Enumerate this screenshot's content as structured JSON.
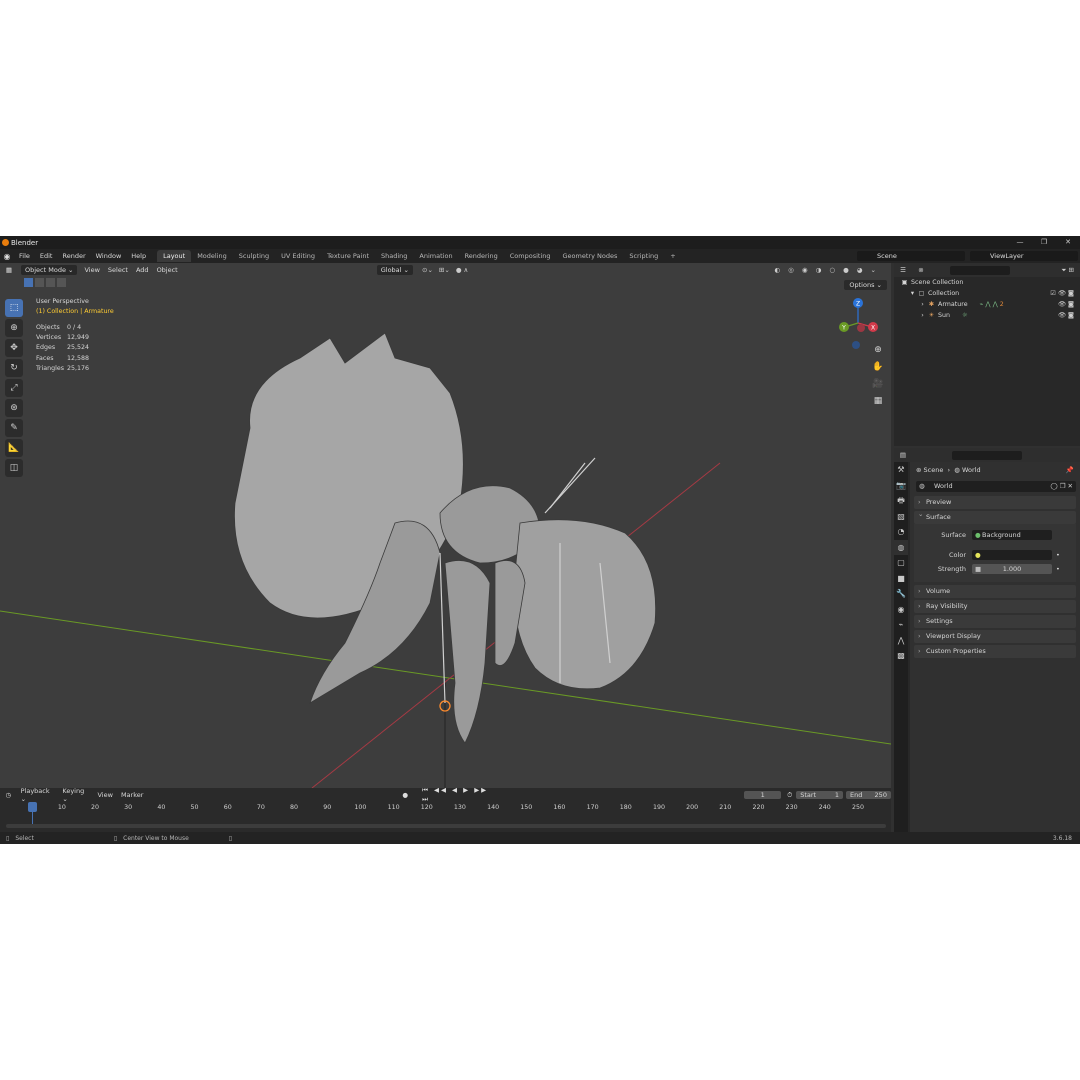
{
  "window": {
    "title": "Blender",
    "controls": [
      "—",
      "❐",
      "✕"
    ]
  },
  "menu": {
    "items": [
      "File",
      "Edit",
      "Render",
      "Window",
      "Help"
    ],
    "tabs": [
      "Layout",
      "Modeling",
      "Sculpting",
      "UV Editing",
      "Texture Paint",
      "Shading",
      "Animation",
      "Rendering",
      "Compositing",
      "Geometry Nodes",
      "Scripting"
    ],
    "active_tab": "Layout",
    "add_tab": "+",
    "scene": "Scene",
    "view_layer": "ViewLayer"
  },
  "viewport_header": {
    "mode": "Object Mode",
    "menus": [
      "View",
      "Select",
      "Add",
      "Object"
    ],
    "transform_orientation": "Global",
    "options": "Options"
  },
  "viewport_overlay": {
    "view_name": "User Perspective",
    "collection_label": "(1) Collection | Armature",
    "stats": [
      {
        "k": "Objects",
        "v": "0 / 4"
      },
      {
        "k": "Vertices",
        "v": "12,949"
      },
      {
        "k": "Edges",
        "v": "25,524"
      },
      {
        "k": "Faces",
        "v": "12,588"
      },
      {
        "k": "Triangles",
        "v": "25,176"
      }
    ],
    "gizmo_axes": [
      "Z",
      "Y",
      "X"
    ]
  },
  "outliner": {
    "root": "Scene Collection",
    "collection": "Collection",
    "items": [
      "Armature",
      "Sun"
    ],
    "armature_badge": "2"
  },
  "properties": {
    "breadcrumb": [
      "Scene",
      "World"
    ],
    "world_name": "World",
    "panels_top": [
      "Preview"
    ],
    "surface_panel": "Surface",
    "surface": {
      "label": "Surface",
      "value": "Background"
    },
    "color": {
      "label": "Color",
      "value": ""
    },
    "strength": {
      "label": "Strength",
      "value": "1.000"
    },
    "panels_bottom": [
      "Volume",
      "Ray Visibility",
      "Settings",
      "Viewport Display",
      "Custom Properties"
    ]
  },
  "timeline": {
    "menus": [
      "Playback",
      "Keying",
      "View",
      "Marker"
    ],
    "current_frame": "1",
    "start_label": "Start",
    "start": "1",
    "end_label": "End",
    "end": "250",
    "ruler": [
      "1",
      "10",
      "20",
      "30",
      "40",
      "50",
      "60",
      "70",
      "80",
      "90",
      "100",
      "110",
      "120",
      "130",
      "140",
      "150",
      "160",
      "170",
      "180",
      "190",
      "200",
      "210",
      "220",
      "230",
      "240",
      "250"
    ]
  },
  "statusbar": {
    "select": "Select",
    "center": "Center View to Mouse",
    "version": "3.6.18"
  },
  "colors": {
    "accent": "#4772b3",
    "highlight": "#ffcc33",
    "x_axis": "#d13a4a",
    "y_axis": "#6a9a25",
    "z_axis": "#2a73d9"
  }
}
